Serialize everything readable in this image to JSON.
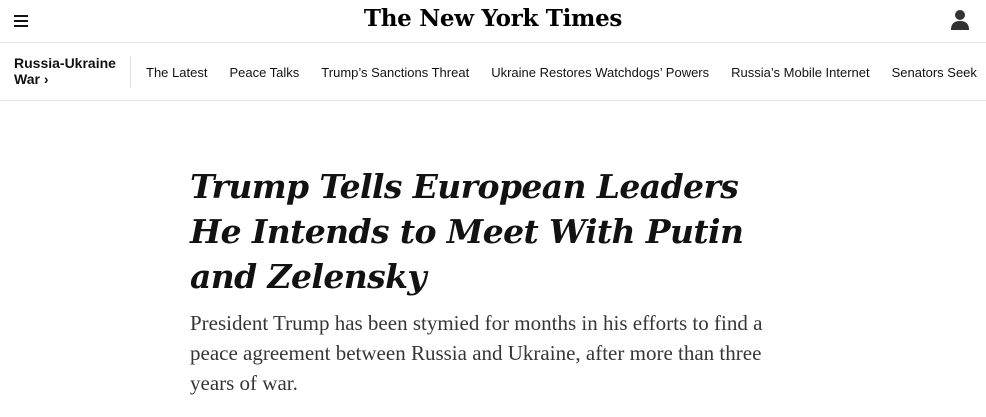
{
  "masthead": {
    "logo_text": "The New York Times",
    "menu_icon": "hamburger-menu-icon",
    "account_icon": "user-account-icon"
  },
  "section_nav": {
    "section_label_line1": "Russia-Ukraine",
    "section_label_line2": "War",
    "section_chevron": "›",
    "items": [
      {
        "label": "The Latest"
      },
      {
        "label": "Peace Talks"
      },
      {
        "label": "Trump’s Sanctions Threat"
      },
      {
        "label": "Ukraine Restores Watchdogs’ Powers"
      },
      {
        "label": "Russia’s Mobile Internet"
      },
      {
        "label": "Senators Seek"
      }
    ]
  },
  "article": {
    "headline": "Trump Tells European Leaders He Intends to Meet With Putin and Zelensky",
    "summary": "President Trump has been stymied for months in his efforts to find a peace agreement between Russia and Ukraine, after more than three years of war."
  }
}
